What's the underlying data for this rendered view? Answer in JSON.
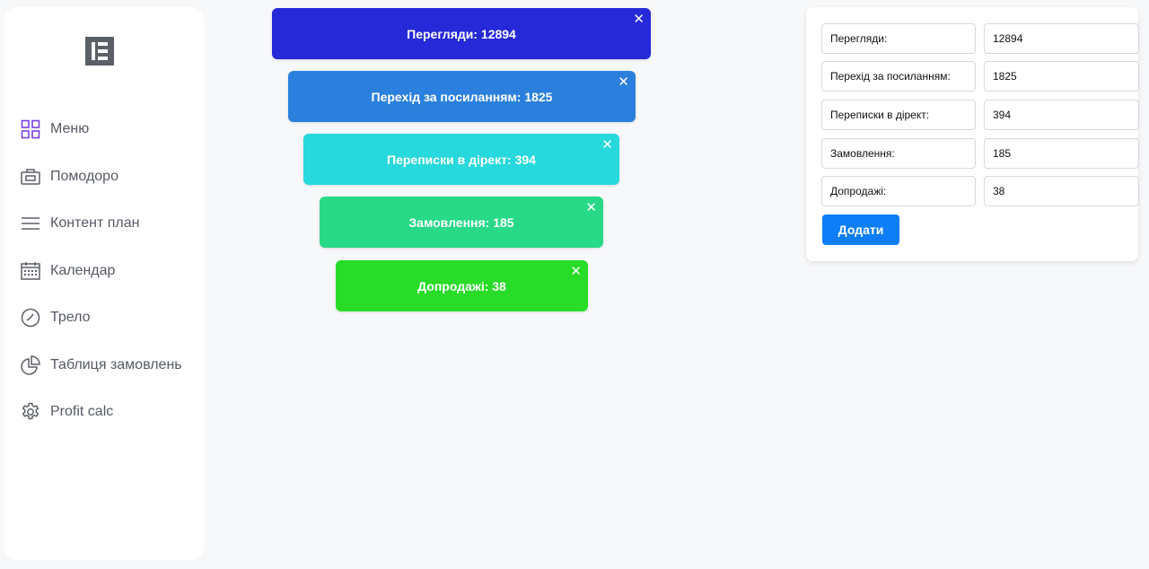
{
  "sidebar": {
    "logo": "logo-icon",
    "items": [
      {
        "label": "Меню",
        "icon": "grid-icon",
        "color": "#7b3fe4"
      },
      {
        "label": "Помодоро",
        "icon": "briefcase-icon"
      },
      {
        "label": "Контент план",
        "icon": "menu-lines-icon"
      },
      {
        "label": "Календар",
        "icon": "calendar-icon"
      },
      {
        "label": "Трело",
        "icon": "clock-icon"
      },
      {
        "label": "Таблиця замовлень",
        "icon": "pie-chart-icon"
      },
      {
        "label": "Profit calc",
        "icon": "gear-icon"
      }
    ]
  },
  "funnel": {
    "close_label": "✕",
    "steps": [
      {
        "text": "Перегляди: 12894",
        "color": "#2529d8"
      },
      {
        "text": "Перехід за посиланням: 1825",
        "color": "#2a80dc"
      },
      {
        "text": "Переписки в дірект: 394",
        "color": "#27d8dc"
      },
      {
        "text": "Замовлення: 185",
        "color": "#28d987"
      },
      {
        "text": "Допродажі: 38",
        "color": "#28dc28"
      }
    ]
  },
  "form": {
    "rows": [
      {
        "label": "Перегляди:",
        "value": "12894"
      },
      {
        "label": "Перехід за посиланням:",
        "value": "1825"
      },
      {
        "label": "Переписки в дірект:",
        "value": "394"
      },
      {
        "label": "Замовлення:",
        "value": "185"
      },
      {
        "label": "Допродажі:",
        "value": "38"
      }
    ],
    "add_label": "Додати",
    "accent": "#0d7ef7"
  }
}
